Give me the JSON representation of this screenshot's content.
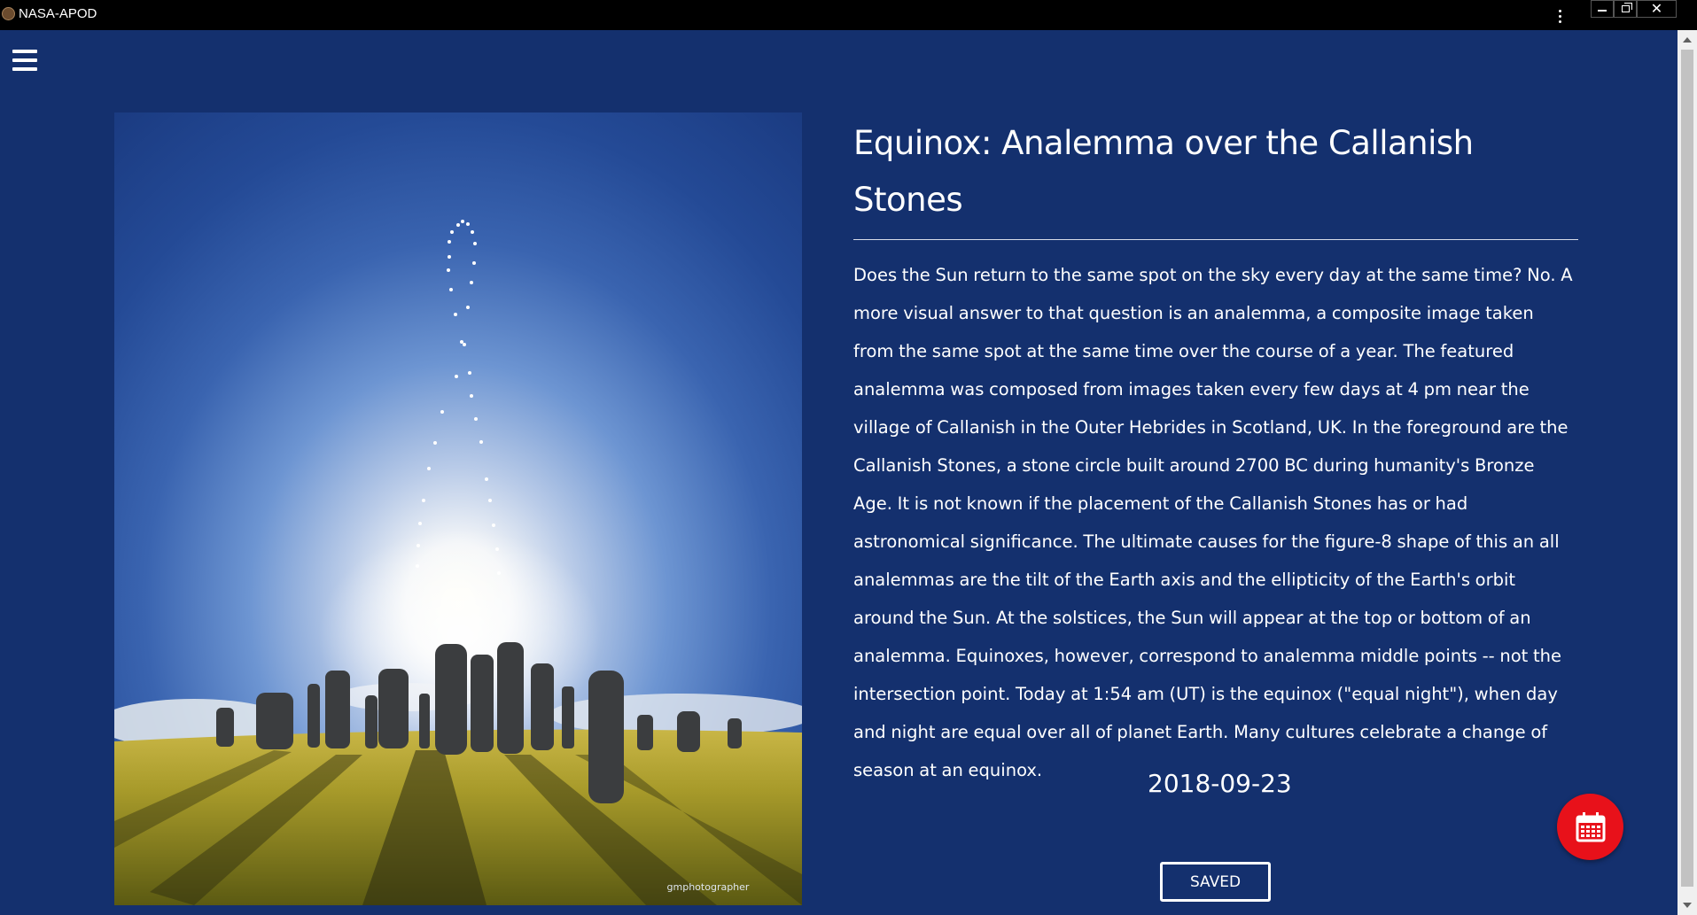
{
  "window": {
    "title": "NASA-APOD",
    "menu_icon": "kebab-menu-icon",
    "minimize_icon": "minimize-icon",
    "maximize_icon": "restore-icon",
    "close_glyph": "✕"
  },
  "nav": {
    "menu_icon": "hamburger-menu-icon"
  },
  "apod": {
    "title": "Equinox: Analemma over the Callanish Stones",
    "explanation": "Does the Sun return to the same spot on the sky every day at the same time? No. A more visual answer to that question is an analemma, a composite image taken from the same spot at the same time over the course of a year. The featured analemma was composed from images taken every few days at 4 pm near the village of Callanish in the Outer Hebrides in Scotland, UK. In the foreground are the Callanish Stones, a stone circle built around 2700 BC during humanity's Bronze Age. It is not known if the placement of the Callanish Stones has or had astronomical significance. The ultimate causes for the figure-8 shape of this an all analemmas are the tilt of the Earth axis and the ellipticity of the Earth's orbit around the Sun. At the solstices, the Sun will appear at the top or bottom of an analemma. Equinoxes, however, correspond to analemma middle points -- not the intersection point. Today at 1:54 am (UT) is the equinox (\"equal night\"), when day and night are equal over all of planet Earth. Many cultures celebrate a change of season at an equinox.",
    "date": "2018-09-23",
    "image_credit": "gmphotographer",
    "saved_label": "SAVED"
  },
  "fab": {
    "icon": "calendar-icon"
  },
  "colors": {
    "background": "#14306e",
    "titlebar": "#000000",
    "fab": "#e8111a",
    "text": "#ffffff"
  }
}
